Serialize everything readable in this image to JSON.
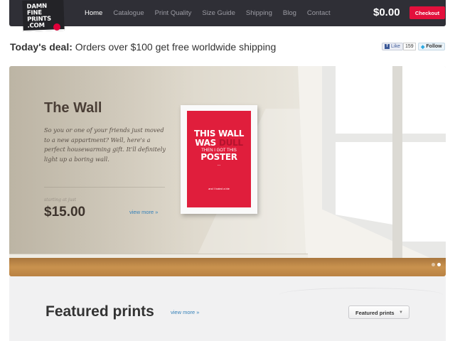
{
  "logo": {
    "lines": [
      "DAMN",
      "FINE",
      "PRINTS",
      ".COM"
    ]
  },
  "nav": {
    "items": [
      "Home",
      "Catalogue",
      "Print Quality",
      "Size Guide",
      "Shipping",
      "Blog",
      "Contact"
    ],
    "active": "Home"
  },
  "cart": {
    "total": "$0.00",
    "checkout_label": "Checkout"
  },
  "deal": {
    "label": "Today's deal:",
    "text": "Orders over $100 get free worldwide shipping"
  },
  "social": {
    "like_label": "Like",
    "like_count": "159",
    "follow_label": "Follow"
  },
  "hero": {
    "title": "The Wall",
    "description": "So you or one of your friends just moved to a new appartment? Well, here's a perfect housewarming gift. It'll definitely light up a boring wall.",
    "price_label": "starting at just",
    "price": "$15.00",
    "view_more": "view more »",
    "poster": {
      "line1": "THIS WALL",
      "line2a": "WAS",
      "line2b": "DULL",
      "line3": "THEN I GOT THIS",
      "line4": "POSTER",
      "small": "...",
      "sign": "and I hated a ble"
    },
    "slides": 2,
    "active_slide": 1
  },
  "featured": {
    "title": "Featured prints",
    "view_more": "view more »",
    "select_value": "Featured prints"
  },
  "colors": {
    "accent": "#e3103c",
    "nav_bg": "#2f2f36",
    "link": "#3580b8"
  }
}
